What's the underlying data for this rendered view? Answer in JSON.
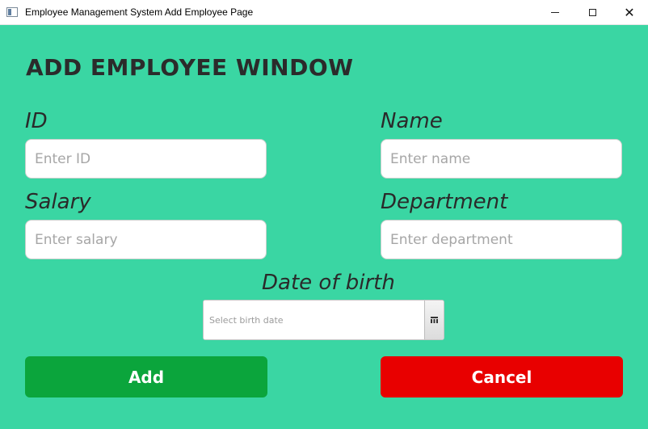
{
  "window": {
    "title": "Employee Management System Add Employee Page",
    "min_label": "",
    "max_label": "",
    "close_label": "✕"
  },
  "page": {
    "heading": "ADD EMPLOYEE WINDOW"
  },
  "fields": {
    "id": {
      "label": "ID",
      "placeholder": "Enter ID",
      "value": ""
    },
    "name": {
      "label": "Name",
      "placeholder": "Enter name",
      "value": ""
    },
    "salary": {
      "label": "Salary",
      "placeholder": "Enter salary",
      "value": ""
    },
    "department": {
      "label": "Department",
      "placeholder": "Enter department",
      "value": ""
    },
    "dob": {
      "label": "Date of birth",
      "placeholder": "Select birth date",
      "value": ""
    }
  },
  "buttons": {
    "add": "Add",
    "cancel": "Cancel"
  },
  "colors": {
    "background": "#3ad6a3",
    "add_button": "#0ba53c",
    "cancel_button": "#e80000"
  },
  "icons": {
    "app": "window-app-icon",
    "calendar": "calendar-icon"
  }
}
